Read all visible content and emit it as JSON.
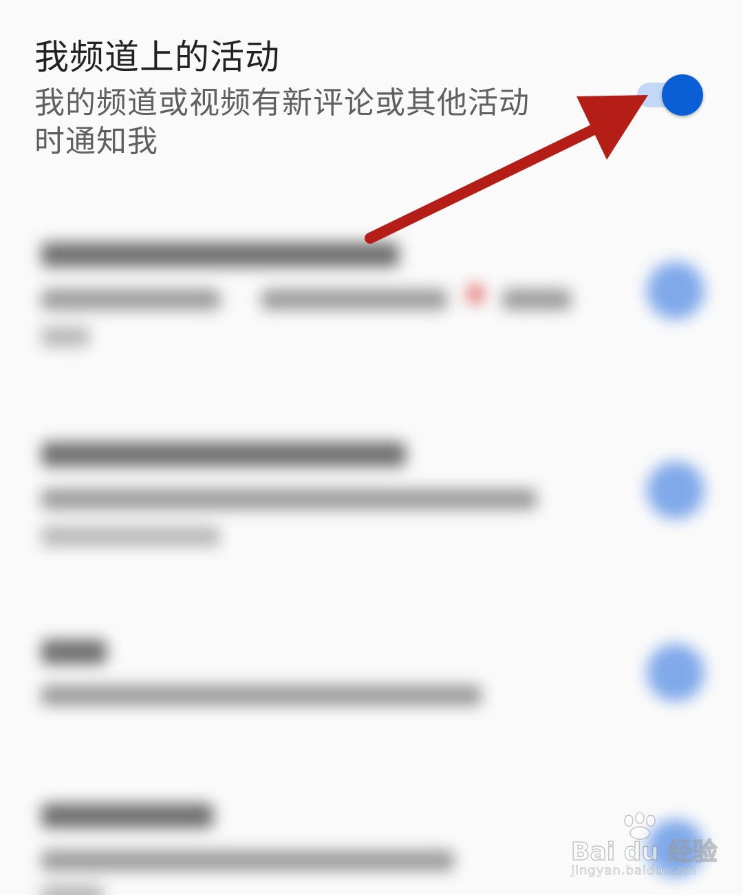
{
  "setting": {
    "title": "我频道上的活动",
    "description": "我的频道或视频有新评论或其他活动时通知我",
    "toggle_on": true
  },
  "colors": {
    "toggle_knob": "#0b5fd6",
    "toggle_track": "#c2d8f6",
    "annotation_arrow": "#b51d17"
  },
  "watermark": {
    "brand": "Bai du 经验",
    "url": "jingyan.baidu.com"
  }
}
